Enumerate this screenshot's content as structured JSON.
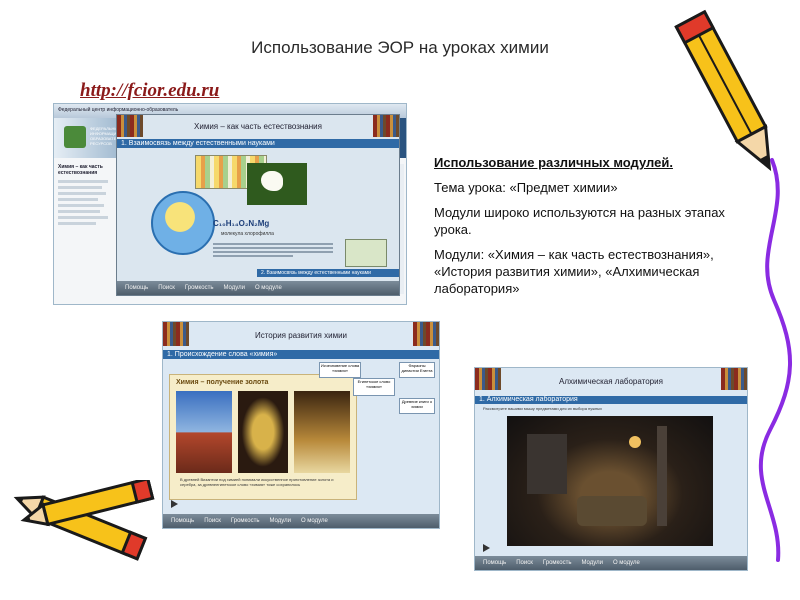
{
  "slide": {
    "title": "Использование ЭОР на уроках химии",
    "url": "http://fcior.edu.ru"
  },
  "text_block": {
    "heading": "Использование различных модулей.",
    "topic": "Тема урока: «Предмет химии»",
    "modules_use": "Модули широко используются на разных этапах урока.",
    "modules_list": "Модули: «Химия – как часть естествознания», «История развития химии», «Алхимическая лаборатория»"
  },
  "shot1": {
    "browser_tab": "Федеральный центр информационно-образовательных ресурсов",
    "site_name": "ФЕДЕРАЛЬНЫЙ ЦЕНТР ИНФОРМАЦИОННО-ОБРАЗОВАТЕЛЬНЫХ РЕСУРСОВ",
    "page_heading": "Химия – как часть естествознания",
    "window_title": "Химия – как часть естествознания",
    "section": "1. Взаимосвязь между естественными науками",
    "formula": "C₁₀H₁₄O₂N₂Mg",
    "formula_caption": "молекула хлорофилла",
    "bottom_section": "2. Взаимосвязь между естественными науками",
    "footer": [
      "Помощь",
      "Поиск",
      "Громкость",
      "Модули",
      "О модуле"
    ]
  },
  "shot2": {
    "window_title": "История развития химии",
    "section": "1. Происхождение слова «химия»",
    "panel_title": "Химия – получение золота",
    "mindmap": [
      "Исчезновение слова «химия»",
      "Египетское слово «химия»",
      "Фараоны династии Египта",
      "Древние книги о химии"
    ],
    "caption": "В древней Византии под химией понимали искусственное приготовление золота и серебра, за древнеегипетское слово «химия» тоже сохранилось",
    "footer": [
      "Помощь",
      "Поиск",
      "Громкость",
      "Модули",
      "О модуле"
    ]
  },
  "shot3": {
    "window_title": "Алхимическая лаборатория",
    "section": "1. Алхимическая лаборатория",
    "hint": "Рассмотрите вашими мышу предметами для их выбора нужных",
    "footer": [
      "Помощь",
      "Поиск",
      "Громкость",
      "Модули",
      "О модуле"
    ]
  },
  "colors": {
    "url": "#8b1a1a",
    "window_bar": "#3f5163",
    "section_bar": "#2f6aa6",
    "pencil_yellow": "#f7c21a",
    "pencil_red": "#e03a2a",
    "pencil_outline": "#1a1a1a",
    "squiggle": "#8a2be2"
  },
  "icons": [
    "pencil-icon",
    "globe-icon",
    "flower-icon",
    "book-shelf-icon",
    "play-icon"
  ]
}
